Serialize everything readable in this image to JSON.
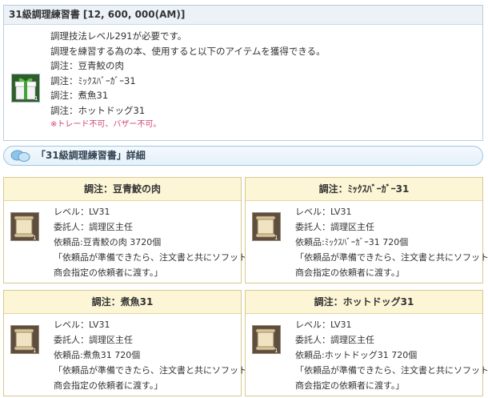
{
  "item": {
    "title": "31級調理練習書 [12, 600, 000(AM)]",
    "lines": [
      "調理技法レベル291が必要です。",
      "調理を練習する為の本、使用すると以下のアイテムを獲得できる。",
      "調注：豆青鮫の肉",
      "調注：ﾐｯｸｽﾊﾞｰｶﾞｰ31",
      "調注：煮魚31",
      "調注：ホットドッグ31"
    ],
    "note": "※トレード不可、バザー不可。",
    "icon_count": "1"
  },
  "section": {
    "title": "「31級調理練習書」詳細"
  },
  "cards": [
    {
      "title": "調注：豆青鮫の肉",
      "level": "レベル：LV31",
      "client": "委託人：調理区主任",
      "request": "依頼品:豆青鮫の肉 3720個",
      "desc1": "「依頼品が準備できたら、注文書と共にソフット",
      "desc2": "商会指定の依頼者に渡す。」",
      "icon_count": "1"
    },
    {
      "title": "調注：ﾐｯｸｽﾊﾞｰｶﾞｰ31",
      "level": "レベル：LV31",
      "client": "委託人：調理区主任",
      "request": "依頼品:ﾐｯｸｽﾊﾞｰｶﾞｰ31 720個",
      "desc1": "「依頼品が準備できたら、注文書と共にソフット",
      "desc2": "商会指定の依頼者に渡す。」",
      "icon_count": "1"
    },
    {
      "title": "調注：煮魚31",
      "level": "レベル：LV31",
      "client": "委託人：調理区主任",
      "request": "依頼品:煮魚31 720個",
      "desc1": "「依頼品が準備できたら、注文書と共にソフット",
      "desc2": "商会指定の依頼者に渡す。」",
      "icon_count": "1"
    },
    {
      "title": "調注：ホットドッグ31",
      "level": "レベル：LV31",
      "client": "委託人：調理区主任",
      "request": "依頼品:ホットドッグ31 720個",
      "desc1": "「依頼品が準備できたら、注文書と共にソフット",
      "desc2": "商会指定の依頼者に渡す。」",
      "icon_count": "1"
    }
  ]
}
